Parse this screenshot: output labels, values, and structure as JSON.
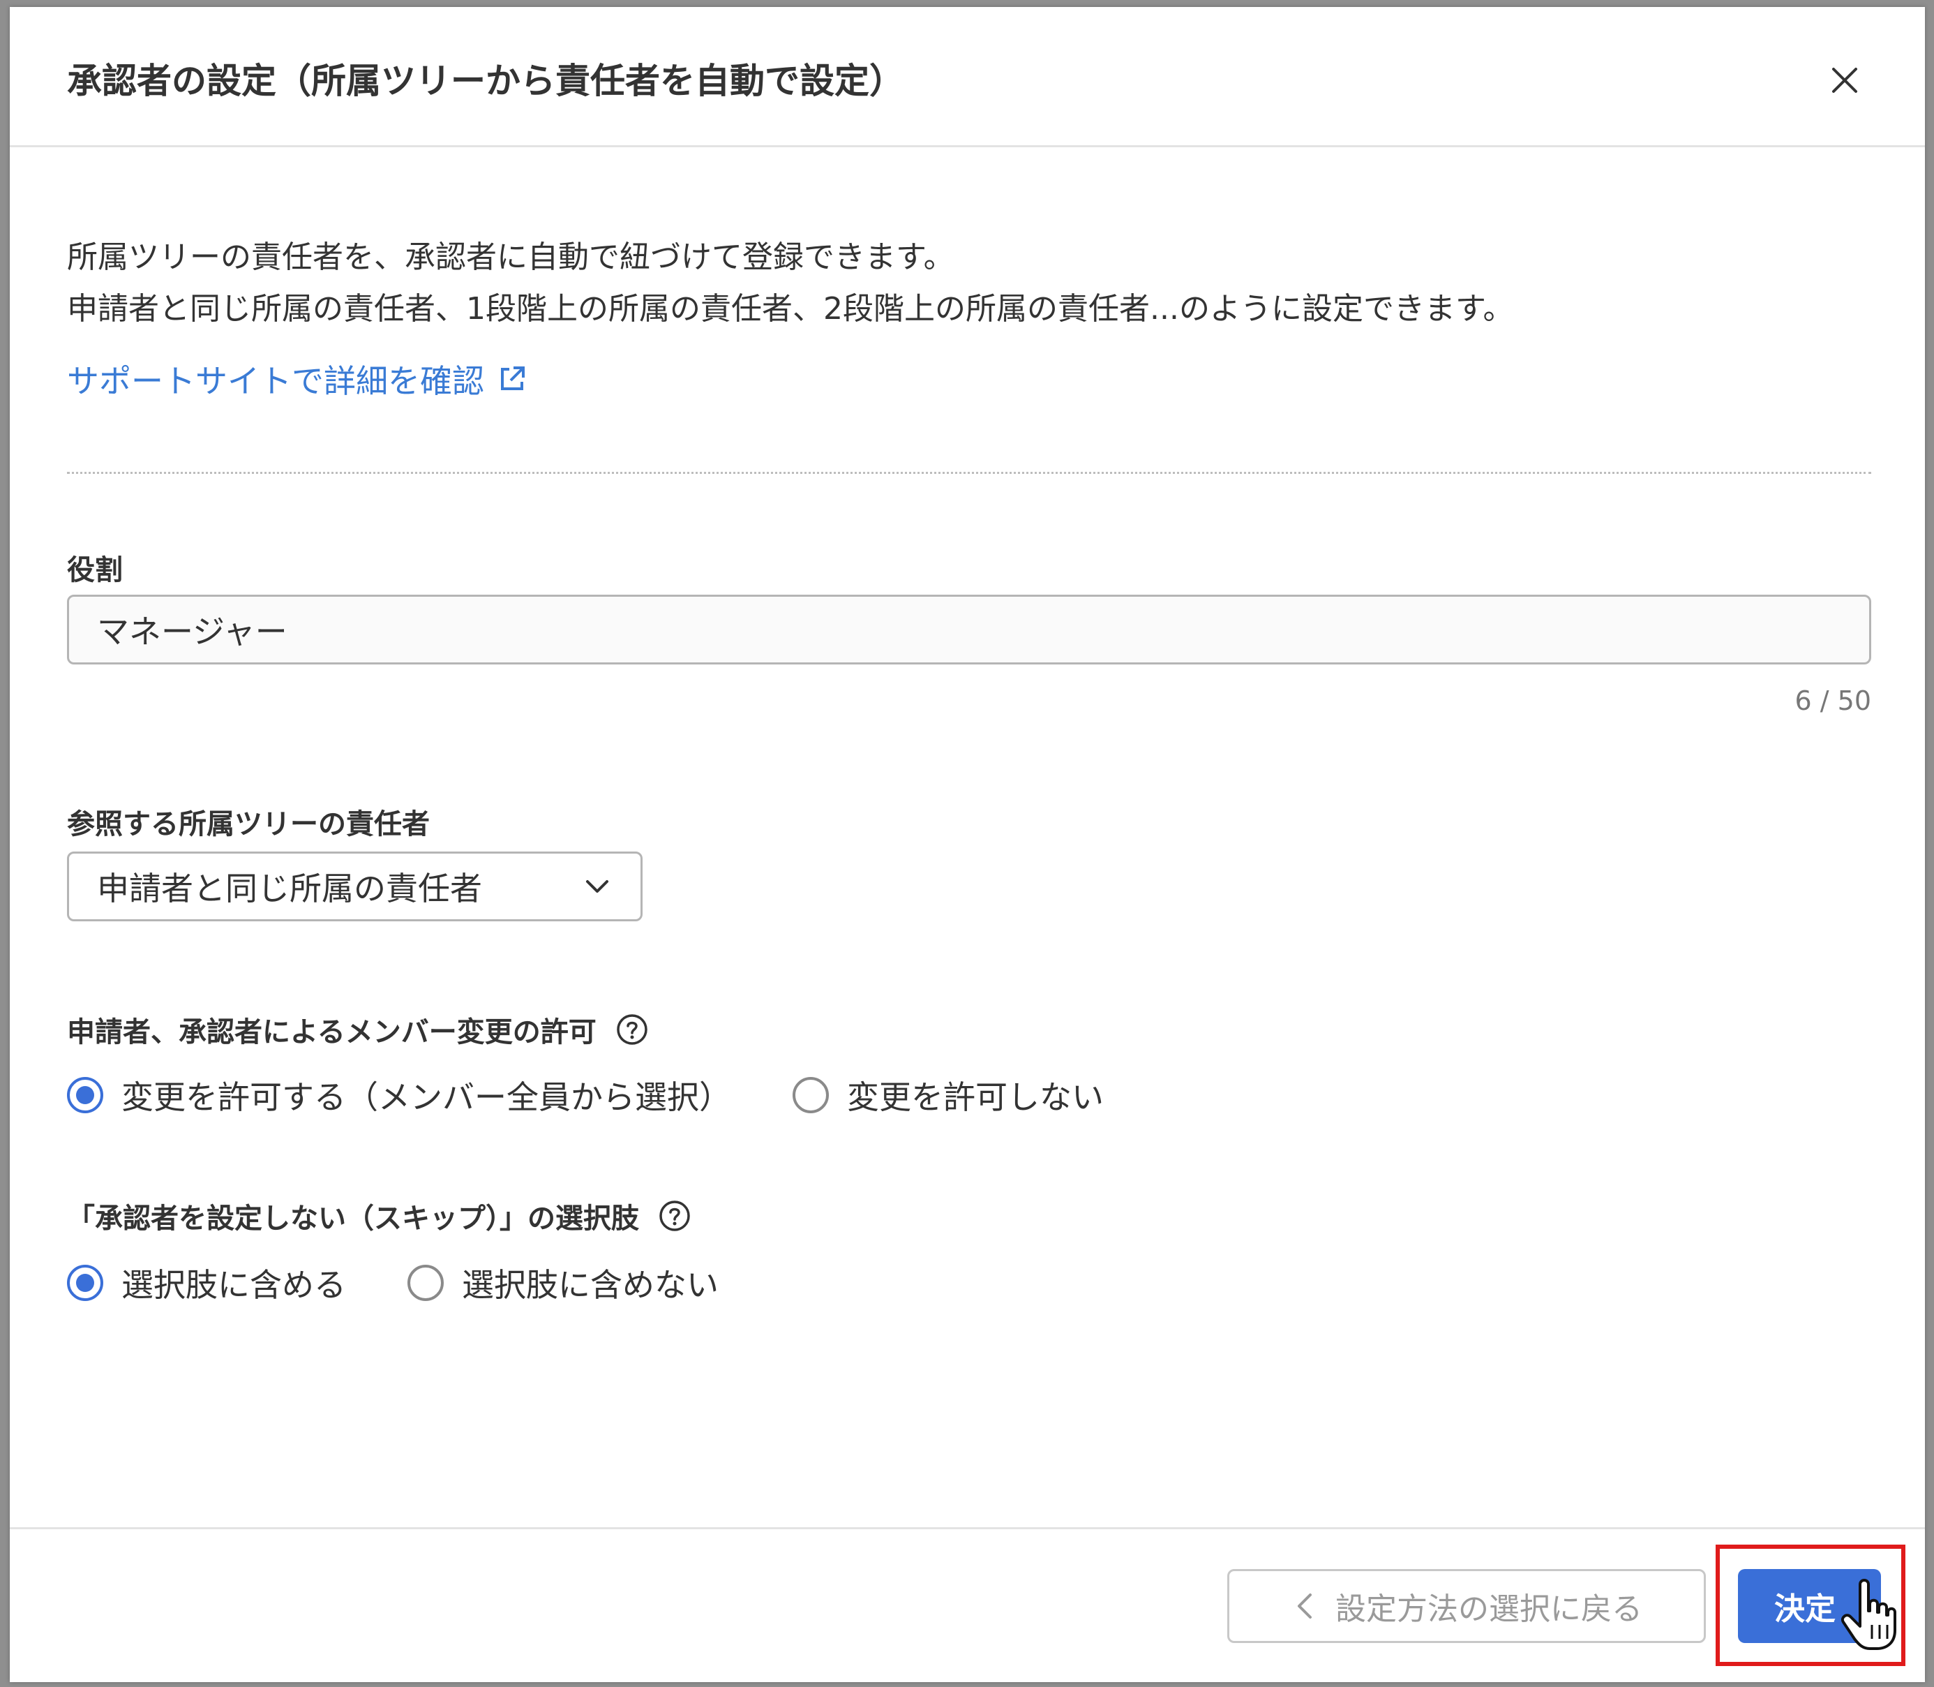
{
  "dialog": {
    "title": "承認者の設定（所属ツリーから責任者を自動で設定）",
    "close_icon": "close-icon"
  },
  "description": {
    "line1": "所属ツリーの責任者を、承認者に自動で紐づけて登録できます。",
    "line2": "申請者と同じ所属の責任者、1段階上の所属の責任者、2段階上の所属の責任者...のように設定できます。"
  },
  "help_link": {
    "label": "サポートサイトで詳細を確認",
    "icon": "external-link-icon",
    "color": "#3a7bd5"
  },
  "role": {
    "label": "役割",
    "value": "マネージャー",
    "counter": "6 / 50"
  },
  "tree_owner": {
    "label": "参照する所属ツリーの責任者",
    "selected": "申請者と同じ所属の責任者"
  },
  "member_change": {
    "label": "申請者、承認者によるメンバー変更の許可",
    "options": [
      {
        "label": "変更を許可する（メンバー全員から選択）",
        "checked": true
      },
      {
        "label": "変更を許可しない",
        "checked": false
      }
    ]
  },
  "skip_option": {
    "label": "「承認者を設定しない（スキップ）」の選択肢",
    "options": [
      {
        "label": "選択肢に含める",
        "checked": true
      },
      {
        "label": "選択肢に含めない",
        "checked": false
      }
    ]
  },
  "footer": {
    "back_label": "設定方法の選択に戻る",
    "confirm_label": "決定"
  },
  "colors": {
    "accent": "#3a6fd8",
    "highlight": "#e01b1b"
  }
}
